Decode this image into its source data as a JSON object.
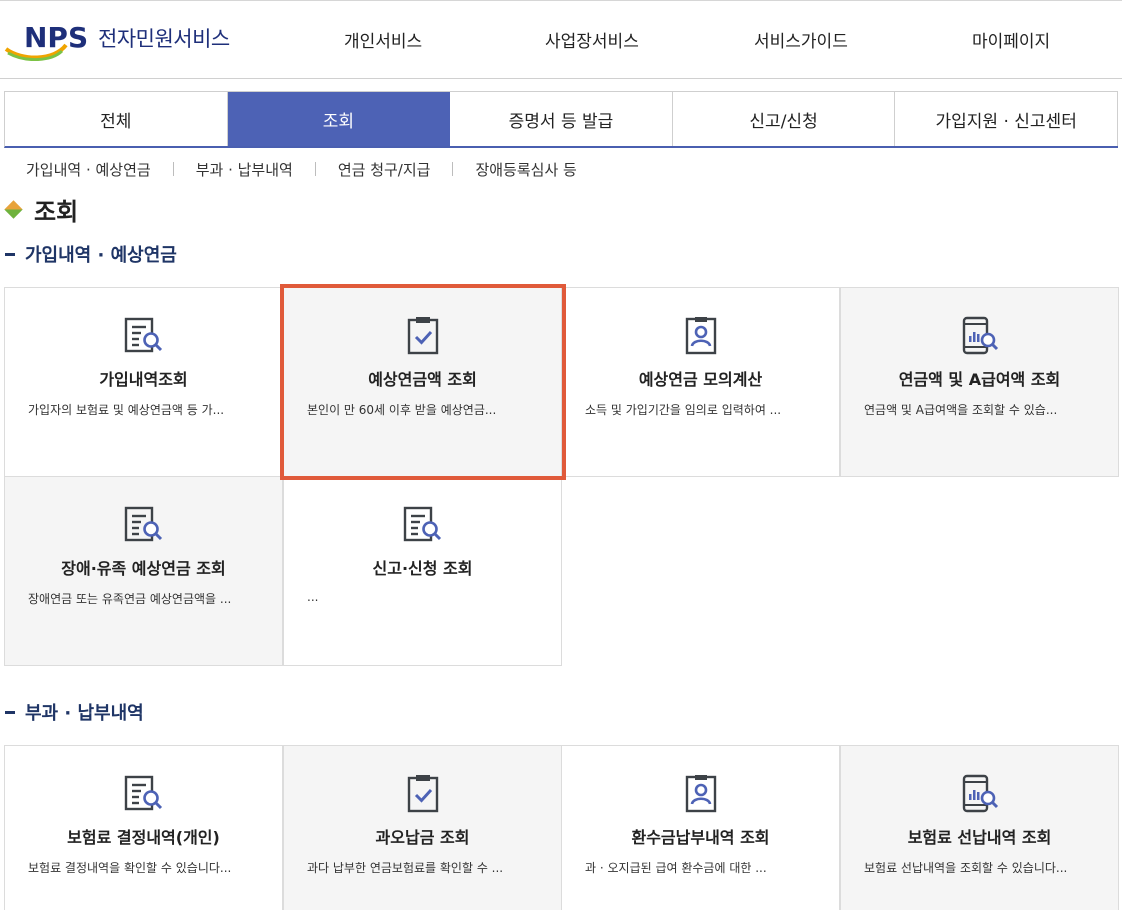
{
  "header": {
    "logo_text": "NPS",
    "service_name": "전자민원서비스",
    "gnb": [
      "개인서비스",
      "사업장서비스",
      "서비스가이드",
      "마이페이지"
    ]
  },
  "tabs": [
    {
      "label": "전체",
      "active": false
    },
    {
      "label": "조회",
      "active": true
    },
    {
      "label": "증명서 등 발급",
      "active": false
    },
    {
      "label": "신고/신청",
      "active": false
    },
    {
      "label": "가입지원 · 신고센터",
      "active": false
    }
  ],
  "subnav": [
    "가입내역 · 예상연금",
    "부과 · 납부내역",
    "연금 청구/지급",
    "장애등록심사 등"
  ],
  "page_title": "조회",
  "sections": [
    {
      "title": "가입내역 · 예상연금",
      "cards": [
        {
          "title": "가입내역조회",
          "desc": "가입자의 보험료 및 예상연금액 등 가...",
          "icon": "document-search-icon"
        },
        {
          "title": "예상연금액 조회",
          "desc": "본인이 만 60세 이후 받을 예상연금...",
          "icon": "clipboard-check-icon"
        },
        {
          "title": "예상연금 모의계산",
          "desc": "소득 및 가입기간을 임의로 입력하여 ...",
          "icon": "id-card-icon"
        },
        {
          "title": "연금액 및 A급여액 조회",
          "desc": "연금액 및 A급여액을 조회할 수 있습...",
          "icon": "mobile-chart-icon"
        },
        {
          "title": "장애·유족 예상연금 조회",
          "desc": "장애연금 또는 유족연금 예상연금액을 ...",
          "icon": "document-search-icon"
        },
        {
          "title": "신고·신청 조회",
          "desc": "...",
          "icon": "document-search-icon"
        }
      ]
    },
    {
      "title": "부과 · 납부내역",
      "cards": [
        {
          "title": "보험료 결정내역(개인)",
          "desc": "보험료 결정내역을 확인할 수 있습니다...",
          "icon": "document-search-icon"
        },
        {
          "title": "과오납금 조회",
          "desc": "과다 납부한 연금보험료를 확인할 수 ...",
          "icon": "clipboard-check-icon"
        },
        {
          "title": "환수금납부내역 조회",
          "desc": "과 · 오지급된 급여 환수금에 대한 ...",
          "icon": "id-card-icon"
        },
        {
          "title": "보험료 선납내역 조회",
          "desc": "보험료 선납내역을 조회할 수 있습니다...",
          "icon": "mobile-chart-icon"
        }
      ]
    }
  ]
}
